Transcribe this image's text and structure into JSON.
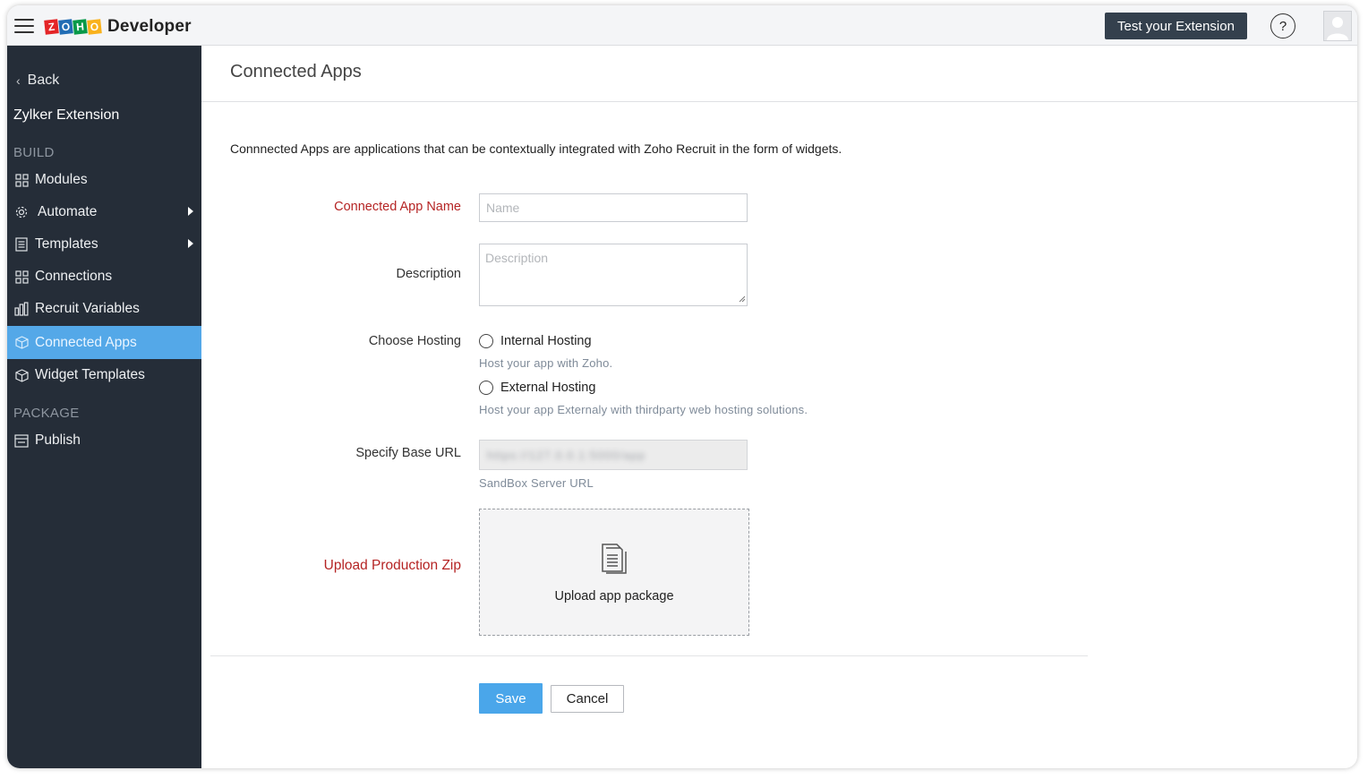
{
  "header": {
    "logo_text": "Developer",
    "logo_letters": [
      "Z",
      "O",
      "H",
      "O"
    ],
    "logo_colors": [
      "#e42527",
      "#226db4",
      "#089949",
      "#f9b21d"
    ],
    "test_button_label": "Test your Extension",
    "help_symbol": "?"
  },
  "sidebar": {
    "back_label": "Back",
    "extension_name": "Zylker Extension",
    "section_build": "BUILD",
    "section_package": "PACKAGE",
    "items": [
      {
        "label": "Modules",
        "icon": "modules-icon"
      },
      {
        "label": "Automate",
        "icon": "gear-icon",
        "has_submenu": true
      },
      {
        "label": "Templates",
        "icon": "document-icon",
        "has_submenu": true
      },
      {
        "label": "Connections",
        "icon": "connections-icon"
      },
      {
        "label": "Recruit Variables",
        "icon": "chart-icon"
      },
      {
        "label": "Connected Apps",
        "icon": "box-icon",
        "active": true
      },
      {
        "label": "Widget Templates",
        "icon": "box-icon"
      },
      {
        "label": "Publish",
        "icon": "publish-icon"
      }
    ],
    "active_color": "#54a8e8",
    "bg_color": "#252d38"
  },
  "main": {
    "page_title": "Connected Apps",
    "description": "Connnected Apps are applications that can be contextually integrated with Zoho Recruit in the form of widgets.",
    "form": {
      "app_name_label": "Connected App Name",
      "app_name_placeholder": "Name",
      "description_label": "Description",
      "description_placeholder": "Description",
      "hosting_label": "Choose Hosting",
      "internal_hosting_label": "Internal Hosting",
      "internal_hosting_hint": "Host your app with Zoho.",
      "external_hosting_label": "External Hosting",
      "external_hosting_hint": "Host your app Externaly with thirdparty web hosting solutions.",
      "base_url_label": "Specify Base URL",
      "base_url_value": "https://127.0.0.1:5000/app",
      "base_url_hint": "SandBox Server URL",
      "upload_label": "Upload Production Zip",
      "upload_text": "Upload app package"
    },
    "save_label": "Save",
    "cancel_label": "Cancel",
    "required_color": "#b52424",
    "primary_color": "#4aa6ea"
  }
}
